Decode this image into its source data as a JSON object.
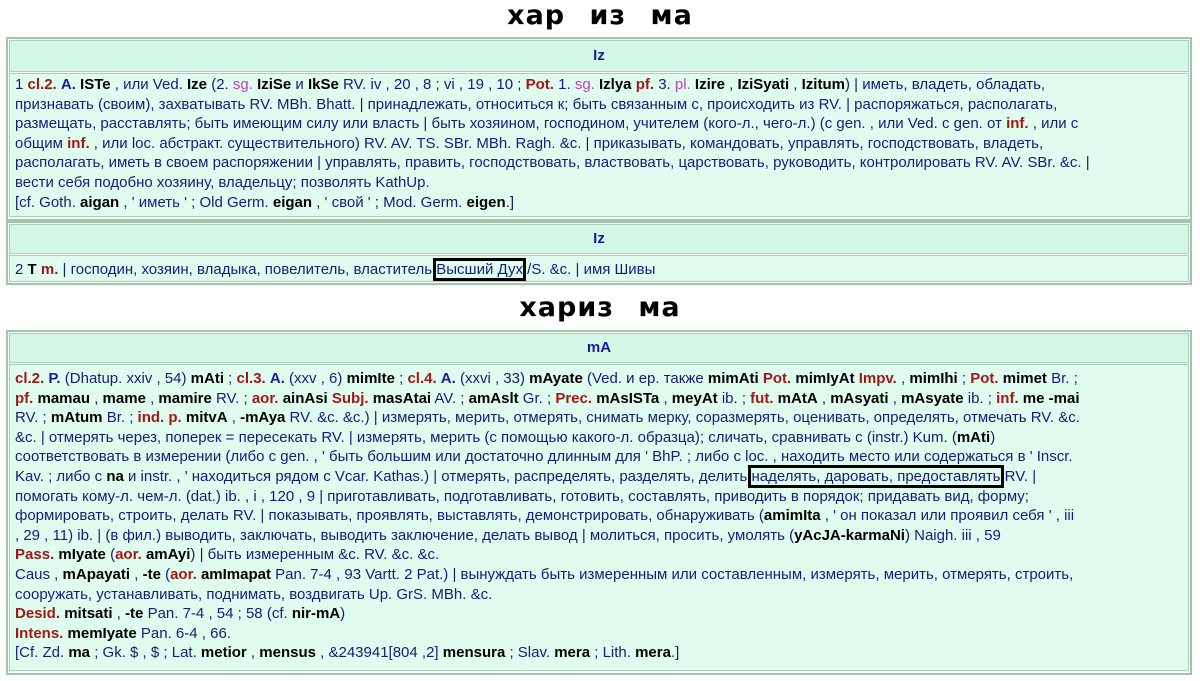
{
  "headings": {
    "top": "хар из ма",
    "bottom": "хариз ма"
  },
  "entry1": {
    "headword": "Iz",
    "body": [
      [
        [
          "1 ",
          ""
        ],
        [
          "cl.2.",
          "r"
        ],
        [
          " ",
          ""
        ],
        [
          "A.",
          "b"
        ],
        [
          " ",
          ""
        ],
        [
          "ISTe",
          "k"
        ],
        [
          " , или Ved. ",
          ""
        ],
        [
          "Ize",
          "k"
        ],
        [
          " (2. ",
          ""
        ],
        [
          "sg.",
          "m"
        ],
        [
          " ",
          ""
        ],
        [
          "IziSe",
          "k"
        ],
        [
          " и ",
          ""
        ],
        [
          "IkSe",
          "k"
        ],
        [
          " RV. iv , 20 , 8 ; vi , 19 , 10 ; ",
          ""
        ],
        [
          "Pot.",
          "r"
        ],
        [
          " 1. ",
          ""
        ],
        [
          "sg.",
          "m"
        ],
        [
          " ",
          ""
        ],
        [
          "Izlya",
          "k"
        ],
        [
          " ",
          ""
        ],
        [
          "pf.",
          "r"
        ],
        [
          " 3. ",
          ""
        ],
        [
          "pl.",
          "m"
        ],
        [
          " ",
          ""
        ],
        [
          "Izire",
          "k"
        ],
        [
          " , ",
          ""
        ],
        [
          "IziSyati",
          "k"
        ],
        [
          " , ",
          ""
        ],
        [
          "Izitum",
          "k"
        ],
        [
          ") | иметь, владеть, обладать,",
          ""
        ]
      ],
      [
        [
          "признавать (своим), захватывать RV. MBh. Bhatt. | принадлежать, относиться к; быть связанным с, происходить из RV. | распоряжаться, располагать,",
          ""
        ]
      ],
      [
        [
          "размещать, расставлять; быть имеющим силу или власть | быть хозяином, господином, учителем (кого-л., чего-л.) (с gen. , или Ved. с gen. от ",
          ""
        ],
        [
          "inf.",
          "r"
        ],
        [
          " , или с",
          ""
        ]
      ],
      [
        [
          "общим ",
          ""
        ],
        [
          "inf.",
          "r"
        ],
        [
          " , или loc. абстракт. существительного) RV. AV. TS. SBr. MBh. Ragh. &c. | приказывать, командовать, управлять, господствовать, владеть,",
          ""
        ]
      ],
      [
        [
          "располагать, иметь в своем распоряжении | управлять, править, господствовать, властвовать, царствовать, руководить, контролировать RV. AV. SBr. &c. |",
          ""
        ]
      ],
      [
        [
          "вести себя подобно хозяину, владельцу; позволять KathUp.",
          ""
        ]
      ],
      [
        [
          "[cf. Goth. ",
          ""
        ],
        [
          "aigan",
          "k"
        ],
        [
          " , ' иметь ' ; Old Germ. ",
          ""
        ],
        [
          "eigan",
          "k"
        ],
        [
          " , ' свой ' ; Mod. Germ. ",
          ""
        ],
        [
          "eigen",
          "k"
        ],
        [
          ".]",
          ""
        ]
      ]
    ]
  },
  "entry2": {
    "headword": "Iz",
    "body": [
      [
        [
          "2 ",
          ""
        ],
        [
          "T",
          "k"
        ],
        [
          " ",
          ""
        ],
        [
          "m.",
          "r"
        ],
        [
          " | господин, хозяин, владыка, повелитель, властитель ",
          ""
        ],
        [
          "Высший Дух",
          "hl"
        ],
        [
          " /S. &c. | имя Шивы",
          ""
        ]
      ]
    ]
  },
  "entry3": {
    "headword": "mA",
    "body": [
      [
        [
          "cl.2.",
          "r"
        ],
        [
          " ",
          ""
        ],
        [
          "P.",
          "b"
        ],
        [
          " (Dhatup. xxiv , 54) ",
          ""
        ],
        [
          "mAti",
          "k"
        ],
        [
          " ; ",
          ""
        ],
        [
          "cl.3.",
          "r"
        ],
        [
          " ",
          ""
        ],
        [
          "A.",
          "b"
        ],
        [
          " (xxv , 6) ",
          ""
        ],
        [
          "mimIte",
          "k"
        ],
        [
          " ; ",
          ""
        ],
        [
          "cl.4.",
          "r"
        ],
        [
          " ",
          ""
        ],
        [
          "A.",
          "b"
        ],
        [
          " (xxvi , 33) ",
          ""
        ],
        [
          "mAyate",
          "k"
        ],
        [
          " (Ved. и ер. также ",
          ""
        ],
        [
          "mimAti",
          "k"
        ],
        [
          " ",
          ""
        ],
        [
          "Pot.",
          "r"
        ],
        [
          " ",
          ""
        ],
        [
          "mimIyAt",
          "k"
        ],
        [
          " ",
          ""
        ],
        [
          "Impv.",
          "r"
        ],
        [
          " , ",
          ""
        ],
        [
          "mimIhi",
          "k"
        ],
        [
          " ; ",
          ""
        ],
        [
          "Pot.",
          "r"
        ],
        [
          " ",
          ""
        ],
        [
          "mimet",
          "k"
        ],
        [
          " Br. ;",
          ""
        ]
      ],
      [
        [
          "pf.",
          "r"
        ],
        [
          " ",
          ""
        ],
        [
          "mamau",
          "k"
        ],
        [
          " , ",
          ""
        ],
        [
          "mame",
          "k"
        ],
        [
          " , ",
          ""
        ],
        [
          "mamire",
          "k"
        ],
        [
          " RV. ; ",
          ""
        ],
        [
          "aor.",
          "r"
        ],
        [
          " ",
          ""
        ],
        [
          "ainAsi",
          "k"
        ],
        [
          " ",
          ""
        ],
        [
          "Subj.",
          "r"
        ],
        [
          " ",
          ""
        ],
        [
          "masAtai",
          "k"
        ],
        [
          " AV. ; ",
          ""
        ],
        [
          "amAslt",
          "k"
        ],
        [
          " Gr. ; ",
          ""
        ],
        [
          "Prec.",
          "r"
        ],
        [
          " ",
          ""
        ],
        [
          "mAsISTa",
          "k"
        ],
        [
          " , ",
          ""
        ],
        [
          "meyAt",
          "k"
        ],
        [
          " ib. ; ",
          ""
        ],
        [
          "fut.",
          "r"
        ],
        [
          " ",
          ""
        ],
        [
          "mAtA",
          "k"
        ],
        [
          " , ",
          ""
        ],
        [
          "mAsyati",
          "k"
        ],
        [
          " , ",
          ""
        ],
        [
          "mAsyate",
          "k"
        ],
        [
          " ib. ; ",
          ""
        ],
        [
          "inf.",
          "r"
        ],
        [
          " ",
          ""
        ],
        [
          "me -mai",
          "k"
        ],
        [
          "",
          ""
        ]
      ],
      [
        [
          "RV. ; ",
          ""
        ],
        [
          "mAtum",
          "k"
        ],
        [
          " Br. ; ",
          ""
        ],
        [
          "ind. p.",
          "r"
        ],
        [
          " ",
          ""
        ],
        [
          "mitvA",
          "k"
        ],
        [
          " , ",
          ""
        ],
        [
          "-mAya",
          "k"
        ],
        [
          " RV. &c. &c.) | измерять, мерить, отмерять, снимать мерку, соразмерять, оценивать, определять, отмечать RV. &c.",
          ""
        ]
      ],
      [
        [
          "&c. | отмерять через, поперек = пересекать RV. | измерять, мерить (с помощью какого-л. образца); сличать, сравнивать с (instr.) Kum. (",
          ""
        ],
        [
          "mAti",
          "k"
        ],
        [
          ")",
          ""
        ]
      ],
      [
        [
          "соответствовать в измерении (либо с gen. , ' быть большим или достаточно длинным для ' BhP. ; либо с loc. , находить место или содержаться в ' Inscr.",
          ""
        ]
      ],
      [
        [
          "Kav. ; либо с ",
          ""
        ],
        [
          "na",
          "k"
        ],
        [
          " и instr. , ' находиться рядом с Vcar. Kathas.) | отмерять, распределять, разделять, делить ",
          ""
        ],
        [
          "наделять, даровать, предоставлять",
          "hl"
        ],
        [
          " RV. |",
          ""
        ]
      ],
      [
        [
          "помогать кому-л. чем-л. (dat.) ib. , i , 120 , 9 | приготавливать, подготавливать, готовить, составлять, приводить в порядок; придавать вид, форму;",
          ""
        ]
      ],
      [
        [
          "формировать, строить, делать RV. | показывать, проявлять, выставлять, демонстрировать, обнаруживать (",
          ""
        ],
        [
          "amimIta",
          "k"
        ],
        [
          " , ' он показал или проявил себя ' , iii",
          ""
        ]
      ],
      [
        [
          ", 29 , 11) ib. | (в фил.) выводить, заключать, выводить заключение, делать вывод | молиться, просить, умолять (",
          ""
        ],
        [
          "yAcJA-karmaNi",
          "k"
        ],
        [
          ") Naigh. iii , 59",
          ""
        ]
      ],
      [
        [
          "Pass.",
          "r"
        ],
        [
          " ",
          ""
        ],
        [
          "mIyate",
          "k"
        ],
        [
          " (",
          ""
        ],
        [
          "aor.",
          "r"
        ],
        [
          " ",
          ""
        ],
        [
          "amAyi",
          "k"
        ],
        [
          ") | быть измеренным &c. RV. &c. &c.",
          ""
        ]
      ],
      [
        [
          "Caus , ",
          ""
        ],
        [
          "mApayati",
          "k"
        ],
        [
          " , ",
          ""
        ],
        [
          "-te",
          "k"
        ],
        [
          " (",
          ""
        ],
        [
          "aor.",
          "r"
        ],
        [
          " ",
          ""
        ],
        [
          "amImapat",
          "k"
        ],
        [
          " Pan. 7-4 , 93 Vartt. 2 Pat.) | вынуждать быть измеренным или составленным, измерять, мерить, отмерять, строить,",
          ""
        ]
      ],
      [
        [
          "сооружать, устанавливать, поднимать, воздвигать Up. GrS. MBh. &c.",
          ""
        ]
      ],
      [
        [
          "Desid.",
          "r"
        ],
        [
          " ",
          ""
        ],
        [
          "mitsati",
          "k"
        ],
        [
          " , ",
          ""
        ],
        [
          "-te",
          "k"
        ],
        [
          " Pan. 7-4 , 54 ; 58 (cf. ",
          ""
        ],
        [
          "nir-mA",
          "k"
        ],
        [
          ")",
          ""
        ]
      ],
      [
        [
          "Intens.",
          "r"
        ],
        [
          " ",
          ""
        ],
        [
          "memIyate",
          "k"
        ],
        [
          " Pan. 6-4 , 66.",
          ""
        ]
      ],
      [
        [
          "[Cf. Zd. ",
          ""
        ],
        [
          "ma",
          "k"
        ],
        [
          " ; Gk. $ , $ ; Lat. ",
          ""
        ],
        [
          "metior",
          "k"
        ],
        [
          " , ",
          ""
        ],
        [
          "mensus",
          "k"
        ],
        [
          " , &243941[804 ,2] ",
          ""
        ],
        [
          "mensura",
          "k"
        ],
        [
          " ; Slav. ",
          ""
        ],
        [
          "mera",
          "k"
        ],
        [
          " ; Lith. ",
          ""
        ],
        [
          "mera",
          "k"
        ],
        [
          ".]",
          ""
        ]
      ]
    ]
  }
}
